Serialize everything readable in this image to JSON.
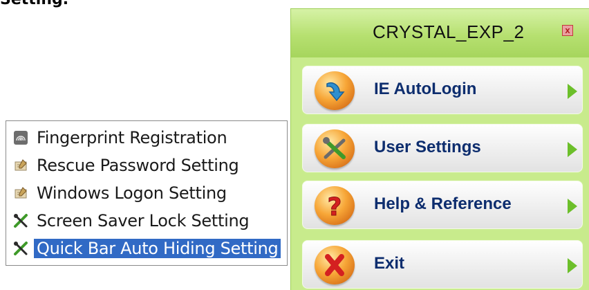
{
  "top_text": "Setting.",
  "context_menu": {
    "items": [
      {
        "label": "Fingerprint Registration",
        "icon": "fingerprint-icon"
      },
      {
        "label": "Rescue Password Setting",
        "icon": "pencil-note-icon"
      },
      {
        "label": "Windows Logon Setting",
        "icon": "pencil-note-icon"
      },
      {
        "label": "Screen Saver Lock Setting",
        "icon": "tools-icon"
      },
      {
        "label": "Quick Bar Auto Hiding Setting",
        "icon": "tools-icon",
        "selected": true
      }
    ]
  },
  "panel": {
    "title": "CRYSTAL_EXP_2",
    "close_symbol": "x",
    "buttons": [
      {
        "label": "IE AutoLogin",
        "icon": "download-arrow-icon"
      },
      {
        "label": "User Settings",
        "icon": "tools-icon"
      },
      {
        "label": "Help & Reference",
        "icon": "question-icon"
      },
      {
        "label": "Exit",
        "icon": "x-icon"
      }
    ]
  },
  "colors": {
    "selection": "#316ac5",
    "panel_green": "#c8eb8c",
    "button_text": "#0d2d6e",
    "arrow_green": "#6cbf2a"
  }
}
